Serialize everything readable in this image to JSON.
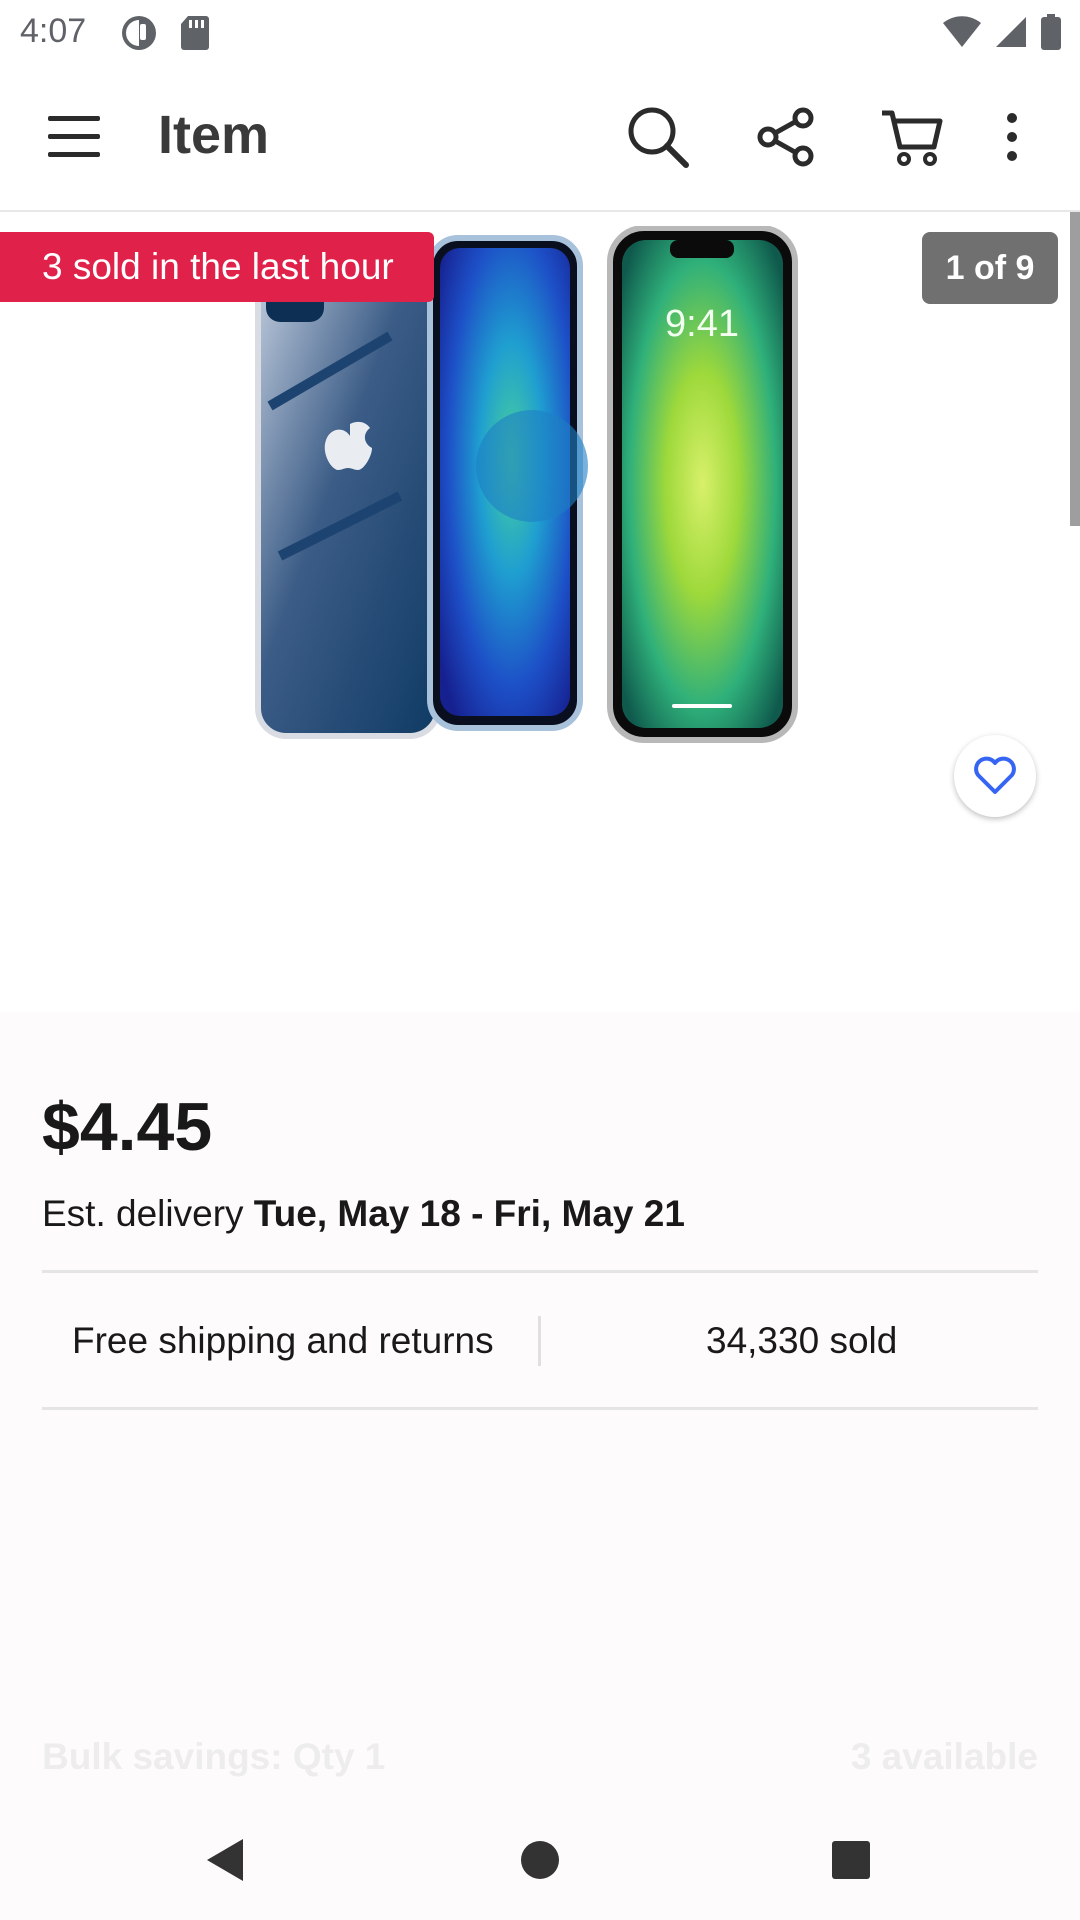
{
  "status_bar": {
    "time": "4:07",
    "icons": [
      "data-saver-icon",
      "sd-card-icon",
      "wifi-icon",
      "signal-icon",
      "battery-icon"
    ]
  },
  "app_bar": {
    "title": "Item",
    "icons": [
      "menu-icon",
      "search-icon",
      "share-icon",
      "cart-icon",
      "more-vert-icon"
    ]
  },
  "gallery": {
    "sold_badge": "3 sold in the last hour",
    "counter": "1 of 9",
    "phone_time": "9:41",
    "favorite_icon": "heart-icon",
    "badge_color": "#e0224a"
  },
  "listing": {
    "price": "$4.45",
    "delivery_prefix": "Est. delivery ",
    "delivery_dates": "Tue, May 18 - Fri, May 21",
    "shipping": "Free shipping and returns",
    "sold_count": "34,330 sold",
    "bulk_savings": "Bulk savings: Qty 1",
    "available": "3 available"
  },
  "nav_bar": {
    "icons": [
      "back-icon",
      "home-icon",
      "recents-icon"
    ]
  },
  "colors": {
    "accent_blue": "#3665f3",
    "text": "#191919"
  }
}
